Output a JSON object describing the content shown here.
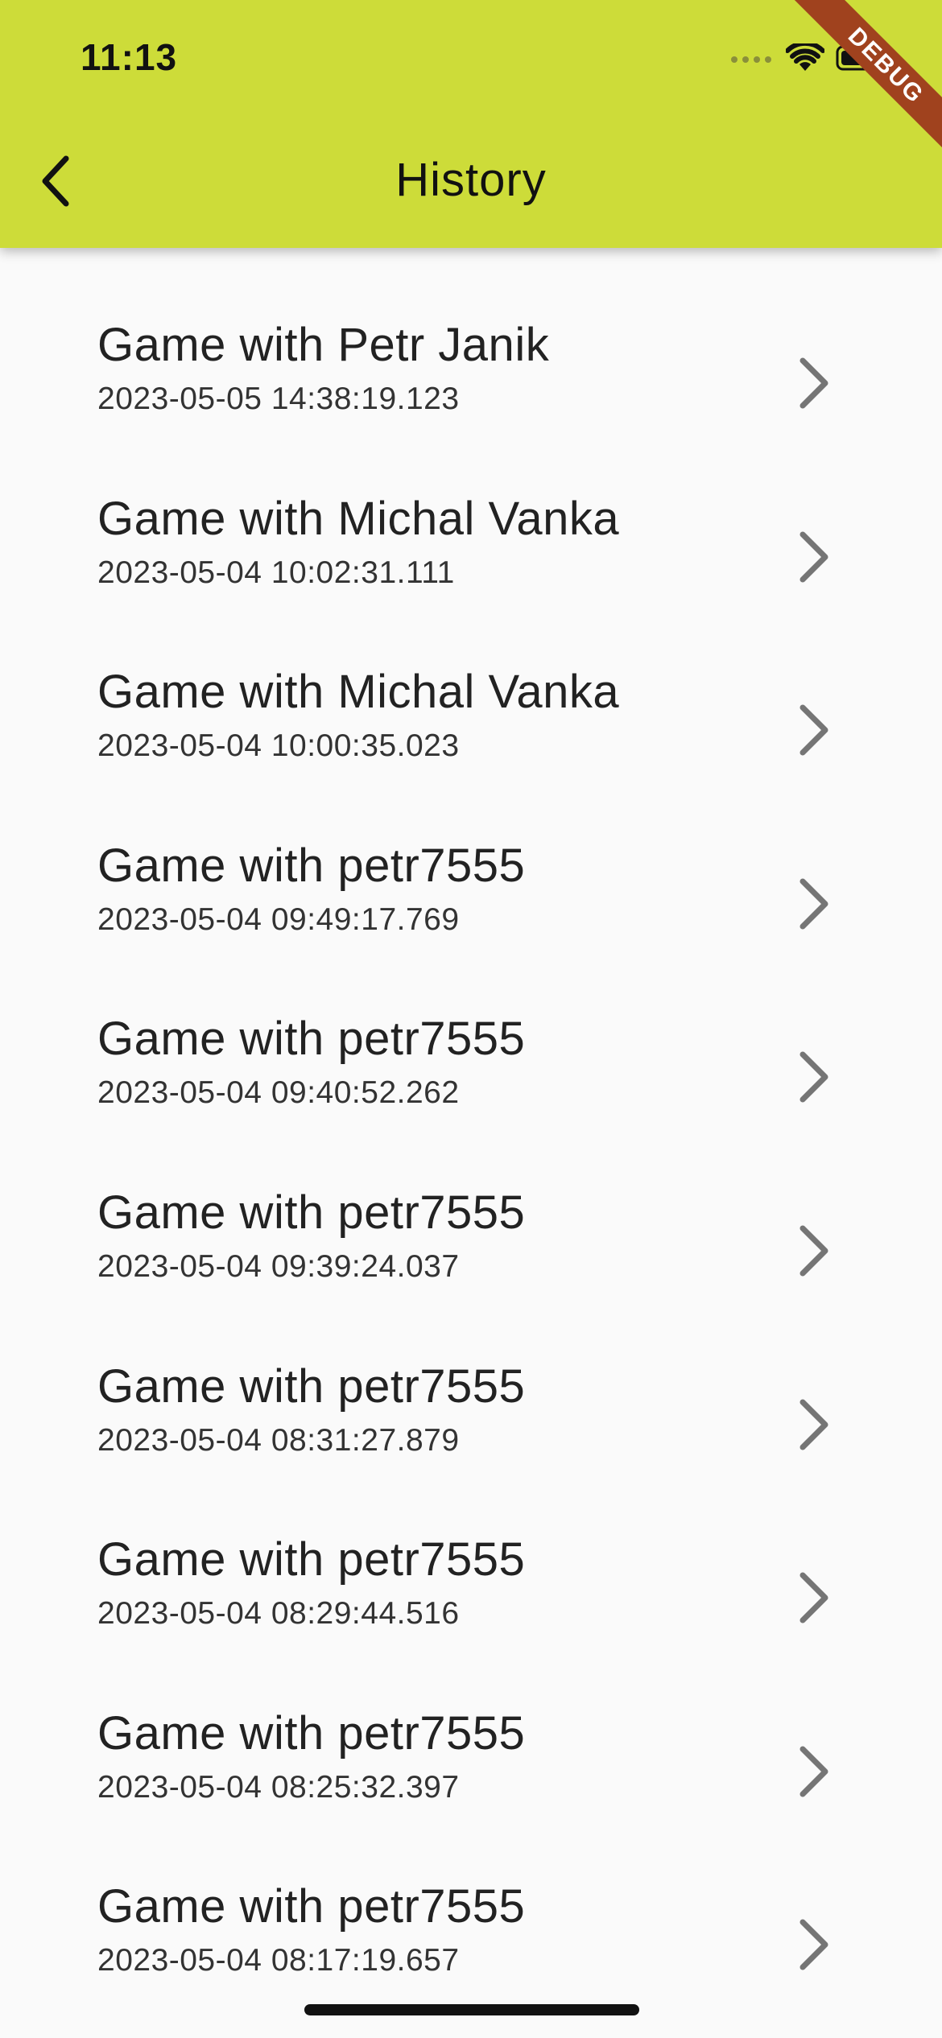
{
  "status_bar": {
    "time": "11:13"
  },
  "app_bar": {
    "title": "History",
    "back_icon": "chevron-left-icon",
    "color": "#cddc39"
  },
  "debug_banner": {
    "label": "DEBUG",
    "color": "#a0421e"
  },
  "history": {
    "items": [
      {
        "title": "Game with Petr Janik",
        "timestamp": "2023-05-05 14:38:19.123"
      },
      {
        "title": "Game with Michal Vanka",
        "timestamp": "2023-05-04 10:02:31.111"
      },
      {
        "title": "Game with Michal Vanka",
        "timestamp": "2023-05-04 10:00:35.023"
      },
      {
        "title": "Game with petr7555",
        "timestamp": "2023-05-04 09:49:17.769"
      },
      {
        "title": "Game with petr7555",
        "timestamp": "2023-05-04 09:40:52.262"
      },
      {
        "title": "Game with petr7555",
        "timestamp": "2023-05-04 09:39:24.037"
      },
      {
        "title": "Game with petr7555",
        "timestamp": "2023-05-04 08:31:27.879"
      },
      {
        "title": "Game with petr7555",
        "timestamp": "2023-05-04 08:29:44.516"
      },
      {
        "title": "Game with petr7555",
        "timestamp": "2023-05-04 08:25:32.397"
      },
      {
        "title": "Game with petr7555",
        "timestamp": "2023-05-04 08:17:19.657"
      }
    ],
    "row_icon": "chevron-right-icon"
  }
}
